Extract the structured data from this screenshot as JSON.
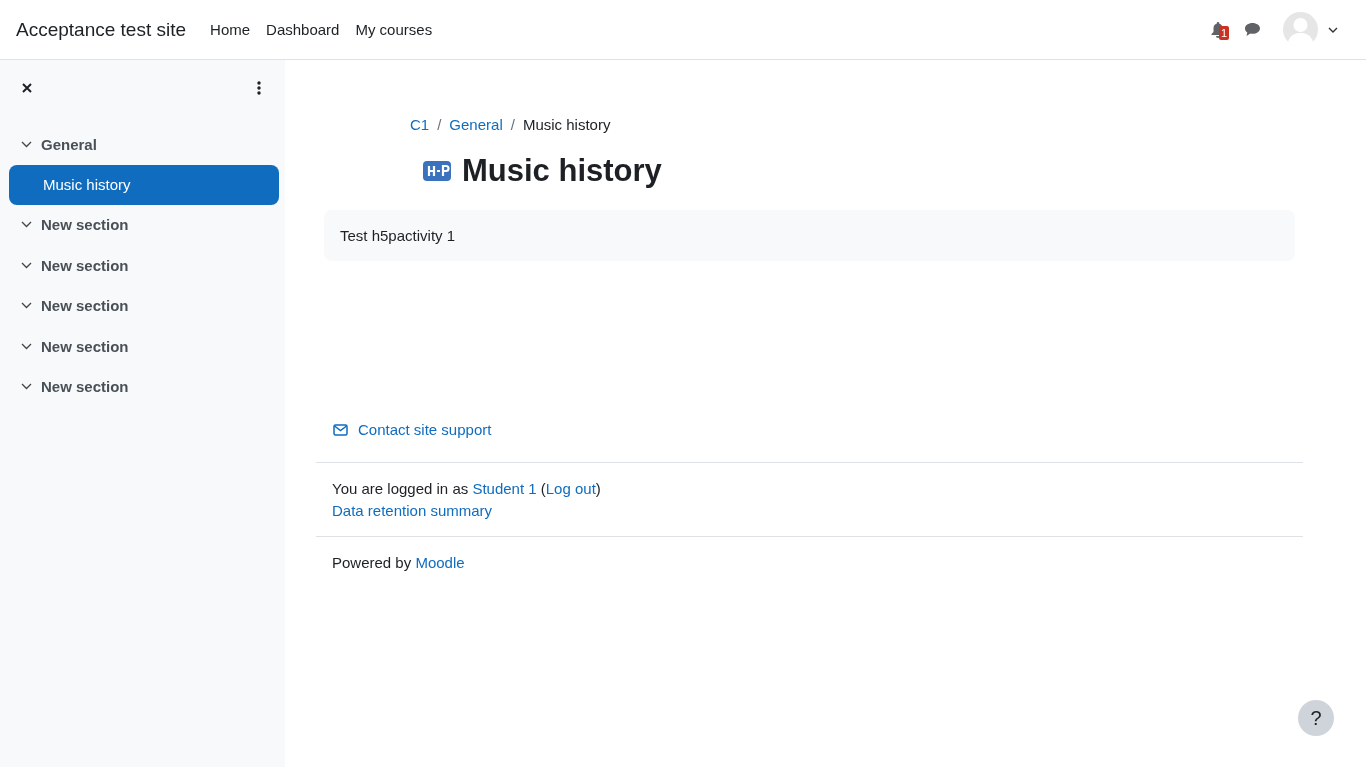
{
  "navbar": {
    "site_name": "Acceptance test site",
    "links": [
      {
        "label": "Home",
        "selected": false
      },
      {
        "label": "Dashboard",
        "selected": false
      },
      {
        "label": "My courses",
        "selected": false
      }
    ],
    "notification_count": "1"
  },
  "drawer": {
    "items": [
      {
        "kind": "section",
        "label": "General",
        "expanded": true,
        "selected": false
      },
      {
        "kind": "activity",
        "label": "Music history",
        "selected": true
      },
      {
        "kind": "section",
        "label": "New section",
        "expanded": true,
        "selected": false
      },
      {
        "kind": "section",
        "label": "New section",
        "expanded": true,
        "selected": false
      },
      {
        "kind": "section",
        "label": "New section",
        "expanded": true,
        "selected": false
      },
      {
        "kind": "section",
        "label": "New section",
        "expanded": true,
        "selected": false
      },
      {
        "kind": "section",
        "label": "New section",
        "expanded": true,
        "selected": false
      }
    ]
  },
  "breadcrumb": [
    {
      "label": "C1",
      "link": true
    },
    {
      "label": "General",
      "link": true
    },
    {
      "label": "Music history",
      "link": false
    }
  ],
  "separator": "/",
  "page_title": "Music history",
  "description": "Test h5pactivity 1",
  "footer": {
    "contact": "Contact site support",
    "logged_in_prefix": "You are logged in as",
    "user": "Student 1",
    "open_paren": "(",
    "logout": "Log out",
    "close_paren": ")",
    "data_retention": "Data retention summary",
    "powered_prefix": "Powered by",
    "powered_link": "Moodle"
  },
  "help": "?"
}
